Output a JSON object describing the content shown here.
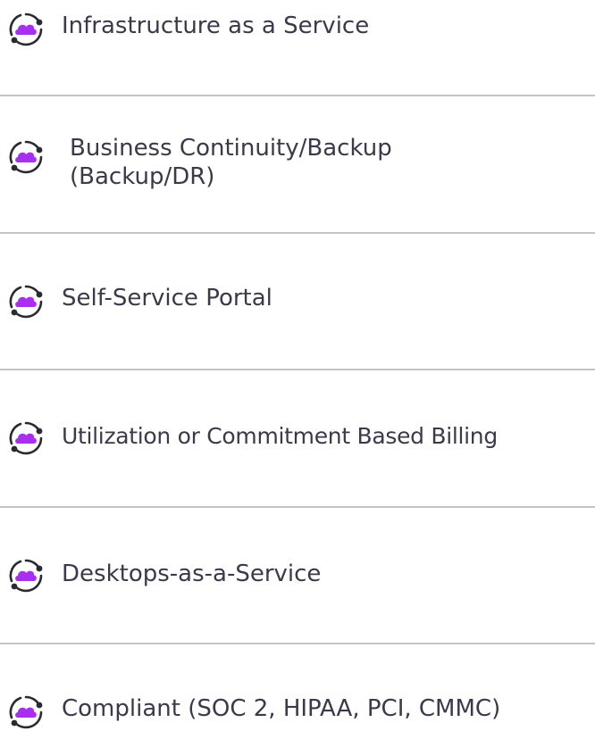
{
  "features": [
    {
      "label": "Infrastructure as a Service",
      "icon": "cloud-cycle-icon"
    },
    {
      "label": "Business Continuity/Backup (Backup/DR)",
      "icon": "cloud-cycle-icon"
    },
    {
      "label": "Self-Service Portal",
      "icon": "cloud-cycle-icon"
    },
    {
      "label": "Utilization or Commitment Based Billing",
      "icon": "cloud-cycle-icon"
    },
    {
      "label": "Desktops-as-a-Service",
      "icon": "cloud-cycle-icon"
    },
    {
      "label": "Compliant (SOC 2, HIPAA, PCI, CMMC)",
      "icon": "cloud-cycle-icon"
    }
  ],
  "colors": {
    "text": "#3a3a4a",
    "cloud": "#a82ff0",
    "ring": "#2a2a32",
    "divider": "#c4c4c8"
  }
}
